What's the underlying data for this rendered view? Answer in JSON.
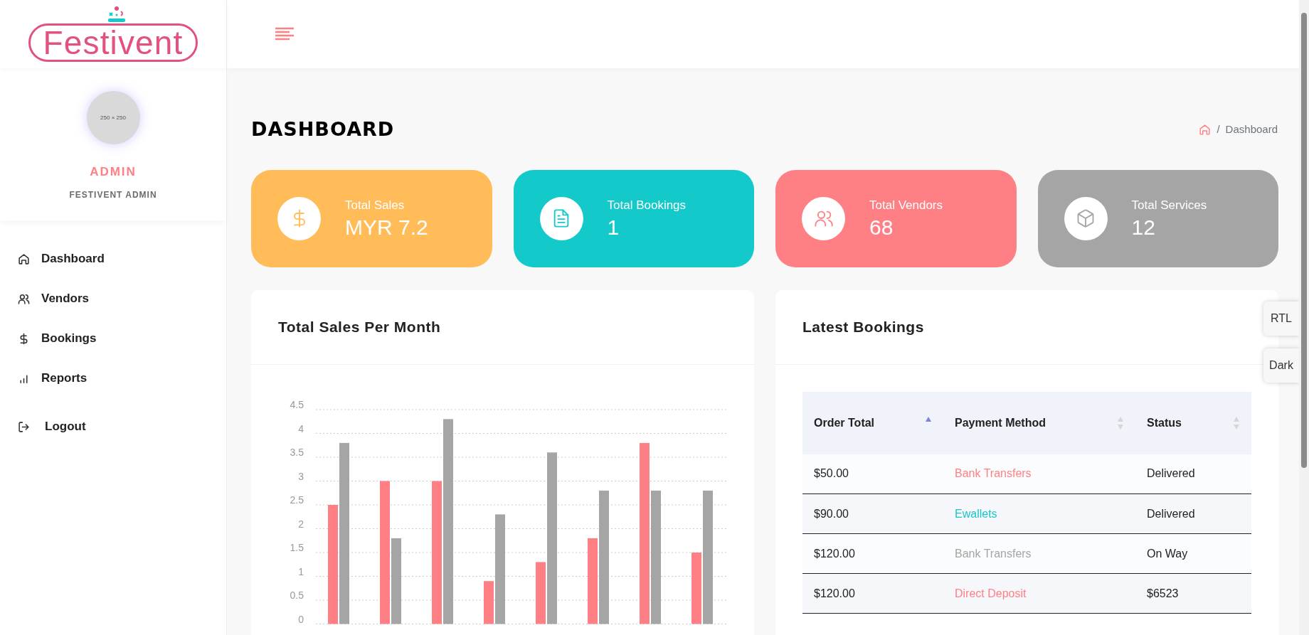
{
  "logo": {
    "text": "Festivent"
  },
  "profile": {
    "avatar_text": "250 × 250",
    "name": "ADMIN",
    "role": "FESTIVENT ADMIN"
  },
  "sidebar": {
    "items": [
      {
        "label": "Dashboard",
        "kind": "home"
      },
      {
        "label": "Vendors",
        "kind": "users"
      },
      {
        "label": "Bookings",
        "kind": "dollar"
      },
      {
        "label": "Reports",
        "kind": "bars"
      },
      {
        "label": "Logout",
        "kind": "logout"
      }
    ]
  },
  "page": {
    "title": "DASHBOARD",
    "breadcrumb_separator": "/",
    "breadcrumb": [
      "Dashboard"
    ]
  },
  "stats": [
    {
      "label": "Total Sales",
      "value": "MYR 7.2",
      "kind": "dollar",
      "color": "#ffbc58"
    },
    {
      "label": "Total Bookings",
      "value": "1",
      "kind": "file",
      "color": "#13c9ca"
    },
    {
      "label": "Total Vendors",
      "value": "68",
      "kind": "users",
      "color": "#ff8084"
    },
    {
      "label": "Total Services",
      "value": "12",
      "kind": "box",
      "color": "#a5a5a5"
    }
  ],
  "sales_chart": {
    "title": "Total Sales Per Month",
    "chart_data": {
      "type": "bar",
      "grid": true,
      "ylim": [
        0,
        4.5
      ],
      "yticks": [
        0,
        0.5,
        1,
        1.5,
        2,
        2.5,
        3,
        3.5,
        4,
        4.5
      ],
      "series": [
        {
          "color": "#ff8084",
          "values": [
            2.5,
            3,
            3,
            0.9,
            1.3,
            1.8,
            3.8,
            1.5
          ]
        },
        {
          "color": "#a5a5a5",
          "values": [
            3.8,
            1.8,
            4.3,
            2.3,
            3.6,
            2.8,
            2.8,
            2.8
          ]
        }
      ]
    }
  },
  "latest_bookings": {
    "title": "Latest Bookings",
    "columns": [
      {
        "label": "Order Total",
        "sorted_ascending": true
      },
      {
        "label": "Payment Method",
        "sorted_ascending": false
      },
      {
        "label": "Status",
        "sorted_ascending": false
      }
    ],
    "rows": [
      {
        "total": "$50.00",
        "method": "Bank Transfers",
        "color": "#ff8084",
        "status": "Delivered"
      },
      {
        "total": "$90.00",
        "method": "Ewallets",
        "color": "#1bc5c8",
        "status": "Delivered"
      },
      {
        "total": "$120.00",
        "method": "Bank Transfers",
        "color": "#a5a5a5",
        "status": "On Way"
      },
      {
        "total": "$120.00",
        "method": "Direct Deposit",
        "color": "#ff8084",
        "status": "$6523"
      }
    ]
  },
  "side_buttons": [
    "RTL",
    "Dark"
  ]
}
